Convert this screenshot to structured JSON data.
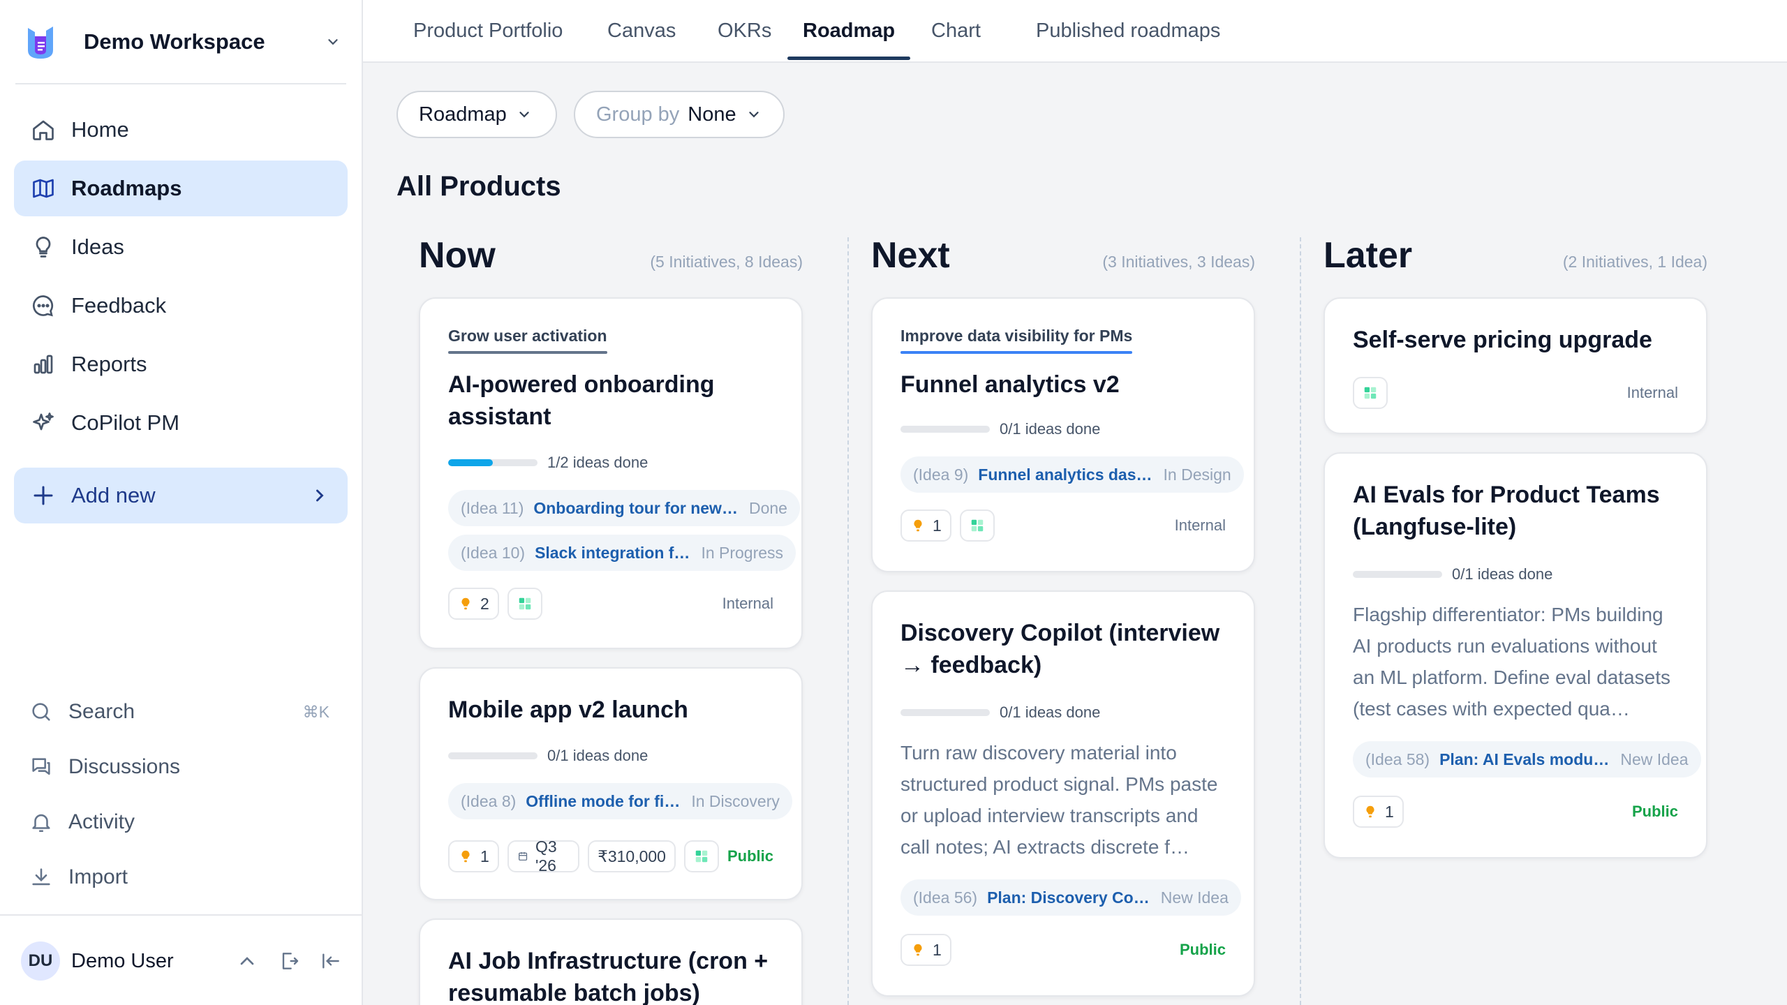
{
  "workspace": {
    "name": "Demo Workspace"
  },
  "nav": [
    {
      "label": "Home",
      "icon": "home-icon"
    },
    {
      "label": "Roadmaps",
      "icon": "map-icon",
      "active": true
    },
    {
      "label": "Ideas",
      "icon": "lightbulb-icon"
    },
    {
      "label": "Feedback",
      "icon": "chat-bubble-icon"
    },
    {
      "label": "Reports",
      "icon": "bar-chart-icon"
    },
    {
      "label": "CoPilot PM",
      "icon": "sparkles-icon"
    }
  ],
  "add_new": {
    "label": "Add new"
  },
  "utility": {
    "search": {
      "label": "Search",
      "shortcut": "⌘K"
    },
    "discussions": {
      "label": "Discussions"
    },
    "activity": {
      "label": "Activity"
    },
    "import": {
      "label": "Import"
    }
  },
  "user": {
    "initials": "DU",
    "name": "Demo User"
  },
  "tabs": [
    "Product Portfolio",
    "Canvas",
    "OKRs",
    "Roadmap",
    "Chart",
    "Published roadmaps"
  ],
  "active_tab": "Roadmap",
  "toolbar": {
    "view": "Roadmap",
    "group_by_label": "Group by",
    "group_by_value": "None"
  },
  "page_title": "All Products",
  "columns": [
    {
      "title": "Now",
      "count": "(5 Initiatives, 8 Ideas)",
      "cards": [
        {
          "initiative": "Grow user activation",
          "title": "AI-powered onboarding assistant",
          "progress_text": "1/2 ideas done",
          "progress": 0.5,
          "ideas": [
            {
              "num": "(Idea 11)",
              "name": "Onboarding tour for new…",
              "status": "Done"
            },
            {
              "num": "(Idea 10)",
              "name": "Slack integration f…",
              "status": "In Progress"
            }
          ],
          "likes": "2",
          "visibility": "Internal"
        },
        {
          "title": "Mobile app v2 launch",
          "progress_text": "0/1 ideas done",
          "progress": 0,
          "ideas": [
            {
              "num": "(Idea 8)",
              "name": "Offline mode for fi…",
              "status": "In Discovery"
            }
          ],
          "likes": "1",
          "quarter": "Q3 '26",
          "budget": "₹310,000",
          "visibility": "Public"
        },
        {
          "title": "AI Job Infrastructure (cron + resumable batch jobs)"
        }
      ]
    },
    {
      "title": "Next",
      "count": "(3 Initiatives, 3 Ideas)",
      "cards": [
        {
          "initiative": "Improve data visibility for PMs",
          "title": "Funnel analytics v2",
          "progress_text": "0/1 ideas done",
          "progress": 0,
          "ideas": [
            {
              "num": "(Idea 9)",
              "name": "Funnel analytics das…",
              "status": "In Design"
            }
          ],
          "likes": "1",
          "visibility": "Internal"
        },
        {
          "title": "Discovery Copilot (interview → feedback)",
          "progress_text": "0/1 ideas done",
          "progress": 0,
          "description": "Turn raw discovery material into structured product signal. PMs paste or upload interview transcripts and call notes; AI extracts discrete f…",
          "ideas": [
            {
              "num": "(Idea 56)",
              "name": "Plan: Discovery Co…",
              "status": "New Idea"
            }
          ],
          "likes": "1",
          "visibility": "Public"
        }
      ]
    },
    {
      "title": "Later",
      "count": "(2 Initiatives, 1 Idea)",
      "cards": [
        {
          "title": "Self-serve pricing upgrade",
          "visibility": "Internal"
        },
        {
          "title": "AI Evals for Product Teams (Langfuse-lite)",
          "progress_text": "0/1 ideas done",
          "progress": 0,
          "description": "Flagship differentiator: PMs building AI products run evaluations without an ML platform. Define eval datasets (test cases with expected qua…",
          "ideas": [
            {
              "num": "(Idea 58)",
              "name": "Plan: AI Evals modu…",
              "status": "New Idea"
            }
          ],
          "likes": "1",
          "visibility": "Public"
        }
      ]
    }
  ]
}
